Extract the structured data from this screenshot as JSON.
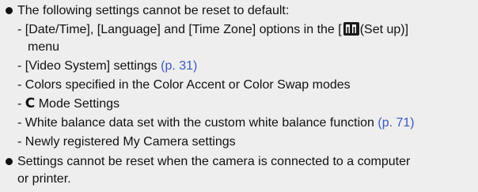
{
  "bullets": [
    {
      "intro": "The following settings cannot be reset to default:"
    },
    {
      "line1": "Settings cannot be reset when the camera is connected to a computer",
      "line2": "or printer."
    }
  ],
  "sub_items": {
    "item1_a": "- [Date/Time], [Language] and [Time Zone] options in the [",
    "item1_b": "(Set up)]",
    "item1_cont": "menu",
    "item2_text": "- [Video System] settings ",
    "item2_link": "(p. 31)",
    "item3": "- Colors specified in the Color Accent or Color Swap modes",
    "item4_dash": "- ",
    "item4_icon": "C",
    "item4_text": " Mode Settings",
    "item5_text": "- White balance data set with the custom white balance function ",
    "item5_link": "(p. 71)",
    "item6": "- Newly registered My Camera settings"
  },
  "icons": {
    "setup": "setup-menu-icon",
    "bullet": "bullet-dot-icon"
  },
  "colors": {
    "link": "#3a58c4",
    "background": "#eeeeee"
  }
}
